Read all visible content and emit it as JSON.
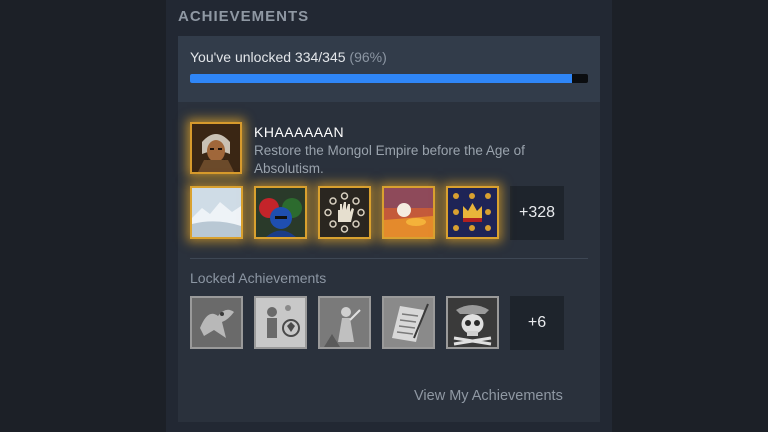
{
  "section": {
    "title": "ACHIEVEMENTS"
  },
  "progress": {
    "label": "You've unlocked 334/345",
    "percent_label": "(96%)",
    "fraction": 0.96
  },
  "featured": {
    "title": "KHAAAAAAN",
    "description": "Restore the Mongol Empire before the Age of Absolutism.",
    "icon": "mongol-warrior-portrait-icon"
  },
  "unlocked": {
    "icons": [
      "snowy-landscape-icon",
      "hooded-figures-icon",
      "hand-circle-icon",
      "sunset-icon",
      "crowns-pattern-icon"
    ],
    "more_label": "+328"
  },
  "locked": {
    "label": "Locked Achievements",
    "icons": [
      "eagle-emblem-icon",
      "diplomat-figures-icon",
      "soldier-statue-icon",
      "document-quill-icon",
      "skull-crossbones-icon"
    ],
    "more_label": "+6"
  },
  "footer": {
    "link_label": "View My Achievements"
  },
  "colors": {
    "progress_fill": "#2f86f7",
    "unlocked_glow": "#d9a12f",
    "background": "#1c2027"
  }
}
